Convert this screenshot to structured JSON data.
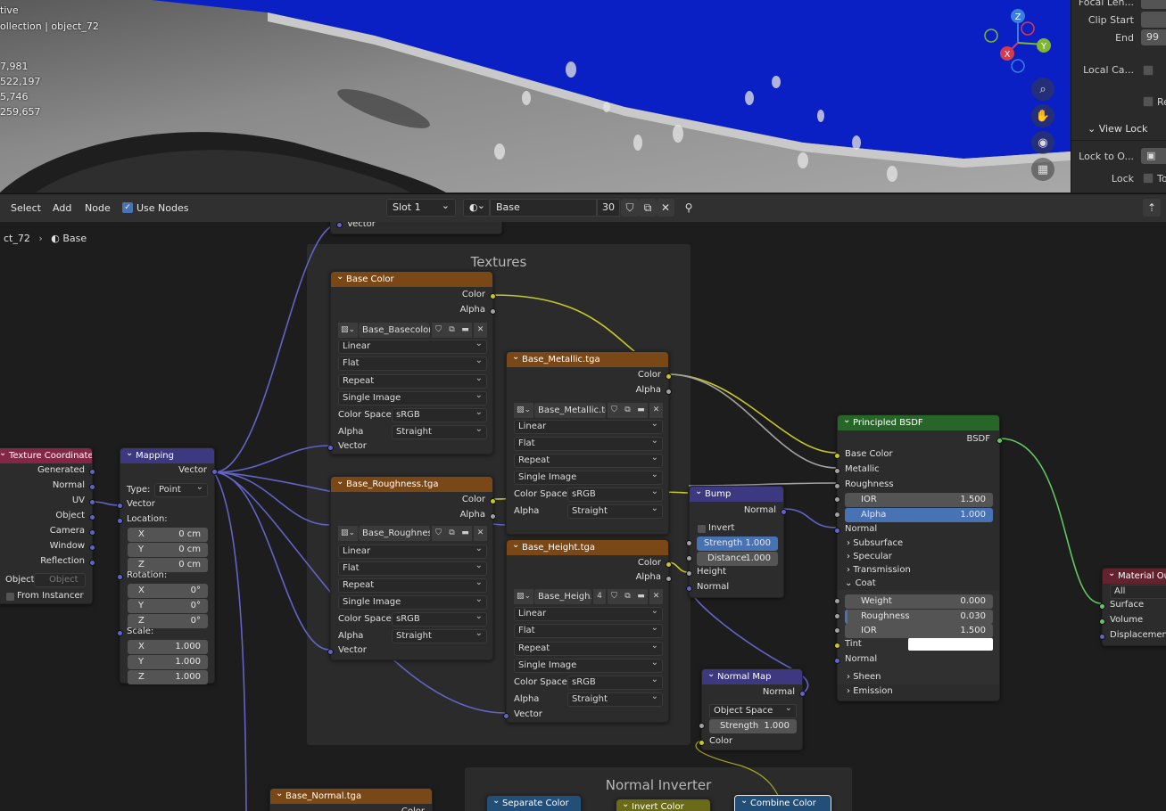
{
  "viewport": {
    "overlay_lines": [
      "tive",
      "ollection | object_72",
      "",
      "7,981",
      "522,197",
      "5,746",
      "259,657"
    ],
    "gizmo": {
      "z": "Z",
      "y": "Y",
      "x": "X"
    },
    "nav_icons": [
      "zoom-icon",
      "hand-icon",
      "camera-icon",
      "grid-icon"
    ]
  },
  "props": {
    "focal": "Focal Len...",
    "clip_start": "Clip Start",
    "end": "End",
    "end_value": "99",
    "local_camera": "Local Ca...",
    "re": "Re",
    "view_lock": "View Lock",
    "lock_to_object": "Lock to O...",
    "lock": "Lock",
    "to": "To"
  },
  "header": {
    "menus": [
      "Select",
      "Add",
      "Node"
    ],
    "use_nodes": "Use Nodes",
    "slot": "Slot 1",
    "material": "Base",
    "users": "30"
  },
  "breadcrumb": {
    "object": "ct_72",
    "material": "Base"
  },
  "frames": {
    "textures": "Textures",
    "normal_inverter": "Normal Inverter"
  },
  "nodes": {
    "top_stub": {
      "vector": "Vector"
    },
    "texture_coordinate": {
      "title": "Texture Coordinate",
      "outputs": [
        "Generated",
        "Normal",
        "UV",
        "Object",
        "Camera",
        "Window",
        "Reflection"
      ],
      "object_label": "Object:",
      "object_placeholder": "Object",
      "from_instancer": "From Instancer"
    },
    "mapping": {
      "title": "Mapping",
      "vector_out": "Vector",
      "type_label": "Type:",
      "type_value": "Point",
      "vector_in": "Vector",
      "location": "Location:",
      "loc": [
        {
          "a": "X",
          "v": "0 cm"
        },
        {
          "a": "Y",
          "v": "0 cm"
        },
        {
          "a": "Z",
          "v": "0 cm"
        }
      ],
      "rotation": "Rotation:",
      "rot": [
        {
          "a": "X",
          "v": "0°"
        },
        {
          "a": "Y",
          "v": "0°"
        },
        {
          "a": "Z",
          "v": "0°"
        }
      ],
      "scale": "Scale:",
      "scl": [
        {
          "a": "X",
          "v": "1.000"
        },
        {
          "a": "Y",
          "v": "1.000"
        },
        {
          "a": "Z",
          "v": "1.000"
        }
      ]
    },
    "base_color": {
      "title": "Base Color",
      "color": "Color",
      "alpha": "Alpha",
      "image": "Base_Basecolor...",
      "interp": "Linear",
      "proj": "Flat",
      "ext": "Repeat",
      "src": "Single Image",
      "cs_label": "Color Space",
      "cs": "sRGB",
      "alpha_label": "Alpha",
      "alpha_mode": "Straight",
      "vector": "Vector"
    },
    "metallic": {
      "title": "Base_Metallic.tga",
      "color": "Color",
      "alpha": "Alpha",
      "image": "Base_Metallic.tga",
      "interp": "Linear",
      "proj": "Flat",
      "ext": "Repeat",
      "src": "Single Image",
      "cs_label": "Color Space",
      "cs": "sRGB",
      "alpha_label": "Alpha",
      "alpha_mode": "Straight",
      "vector": "Vector"
    },
    "roughness": {
      "title": "Base_Roughness.tga",
      "color": "Color",
      "alpha": "Alpha",
      "vector_top": "Vector",
      "image": "Base_Roughness...",
      "interp": "Linear",
      "proj": "Flat",
      "ext": "Repeat",
      "src": "Single Image",
      "cs_label": "Color Space",
      "cs": "sRGB",
      "alpha_label": "Alpha",
      "alpha_mode": "Straight",
      "vector": "Vector"
    },
    "height": {
      "title": "Base_Height.tga",
      "color": "Color",
      "alpha": "Alpha",
      "image": "Base_Heigh...",
      "users": "4",
      "interp": "Linear",
      "proj": "Flat",
      "ext": "Repeat",
      "src": "Single Image",
      "cs_label": "Color Space",
      "cs": "sRGB",
      "alpha_label": "Alpha",
      "alpha_mode": "Straight",
      "vector": "Vector"
    },
    "bump": {
      "title": "Bump",
      "normal_out": "Normal",
      "invert": "Invert",
      "strength": "Strength",
      "strength_v": "1.000",
      "distance": "Distance",
      "distance_v": "1.000",
      "height": "Height",
      "normal_in": "Normal"
    },
    "normal_map": {
      "title": "Normal Map",
      "normal": "Normal",
      "space": "Object Space",
      "strength": "Strength",
      "strength_v": "1.000",
      "color": "Color"
    },
    "principled": {
      "title": "Principled BSDF",
      "bsdf": "BSDF",
      "base_color": "Base Color",
      "metallic": "Metallic",
      "roughness": "Roughness",
      "ior": "IOR",
      "ior_v": "1.500",
      "alpha": "Alpha",
      "alpha_v": "1.000",
      "normal": "Normal",
      "subsurface": "Subsurface",
      "specular": "Specular",
      "transmission": "Transmission",
      "coat": "Coat",
      "weight": "Weight",
      "weight_v": "0.000",
      "coat_rough": "Roughness",
      "coat_rough_v": "0.030",
      "coat_ior": "IOR",
      "coat_ior_v": "1.500",
      "tint": "Tint",
      "coat_normal": "Normal",
      "sheen": "Sheen",
      "emission": "Emission"
    },
    "material_output": {
      "title": "Material Outp",
      "target": "All",
      "surface": "Surface",
      "volume": "Volume",
      "displacement": "Displacement"
    },
    "base_normal": {
      "title": "Base_Normal.tga",
      "color": "Color"
    },
    "separate_color": {
      "title": "Separate Color"
    },
    "invert_color": {
      "title": "Invert Color"
    },
    "combine_color": {
      "title": "Combine Color"
    }
  },
  "colors": {
    "wire_vector": "#6363c7",
    "wire_color": "#c7c729",
    "wire_float": "#a1a1a1",
    "wire_shader": "#63c763",
    "header_texture": "#7a4816",
    "header_vector": "#3c3980",
    "header_shader": "#276628",
    "accent_blue": "#4772b3",
    "viewport_blue": "#0a1fc4"
  }
}
